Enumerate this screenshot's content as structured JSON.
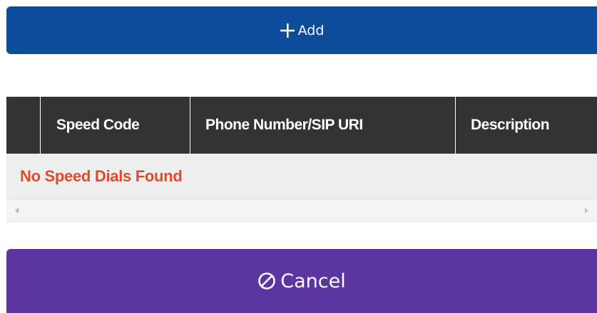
{
  "add_button": {
    "label": "Add",
    "icon": "plus-icon",
    "color": "#0a4c99"
  },
  "speed_dials_table": {
    "columns": [
      {
        "label": ""
      },
      {
        "label": "Speed Code"
      },
      {
        "label": "Phone Number/SIP URI"
      },
      {
        "label": "Description"
      }
    ],
    "empty_message": "No Speed Dials Found",
    "empty_message_color": "#e24a2c",
    "header_color": "#333333"
  },
  "cancel_button": {
    "label": "Cancel",
    "icon": "ban-icon",
    "color": "#5b35a0"
  }
}
